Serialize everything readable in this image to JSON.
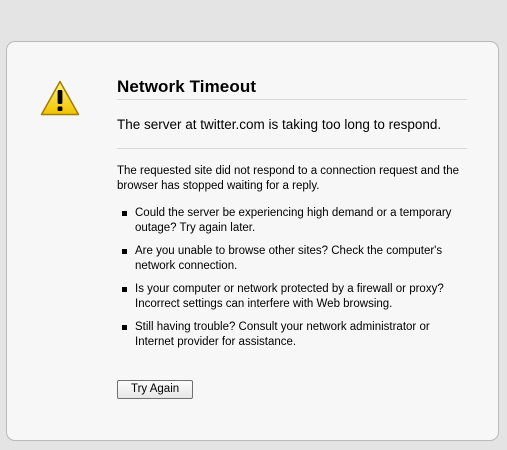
{
  "error": {
    "title": "Network Timeout",
    "short_desc": "The server at twitter.com is taking too long to respond.",
    "long_desc": "The requested site did not respond to a connection request and the browser has stopped waiting for a reply.",
    "tips": [
      "Could the server be experiencing high demand or a temporary outage? Try again later.",
      "Are you unable to browse other sites? Check the computer's network connection.",
      "Is your computer or network protected by a firewall or proxy? Incorrect settings can interfere with Web browsing.",
      "Still having trouble? Consult your network administrator or Internet provider for assistance."
    ],
    "try_again_label": "Try Again",
    "icon": "warning-triangle-icon"
  },
  "colors": {
    "page_background": "#e4e4e4",
    "panel_background": "#f7f7f7",
    "warning_yellow": "#f5d21f"
  }
}
